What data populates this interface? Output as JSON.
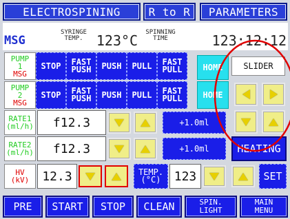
{
  "tabs": {
    "electrospinning": "ELECTROSPINING",
    "r_to_r": "R to R",
    "parameters": "PARAMETERS"
  },
  "header": {
    "msg": "MSG",
    "syringe_temp_l1": "SYRINGE",
    "syringe_temp_l2": "TEMP.",
    "syringe_temp_value": "123°C",
    "spinning_time_l1": "SPINNING",
    "spinning_time_l2": "TIME",
    "spinning_time_value": "123:12:12"
  },
  "pump1": {
    "label_l1": "PUMP",
    "label_l2": "1",
    "label_l3": "MSG",
    "stop": "STOP",
    "fast_push_l1": "FAST",
    "fast_push_l2": "PUSH",
    "push": "PUSH",
    "pull": "PULL",
    "fast_pull_l1": "FAST",
    "fast_pull_l2": "PULL",
    "home": "HOME"
  },
  "pump2": {
    "label_l1": "PUMP",
    "label_l2": "2",
    "label_l3": "MSG",
    "stop": "STOP",
    "fast_push_l1": "FAST",
    "fast_push_l2": "PUSH",
    "push": "PUSH",
    "pull": "PULL",
    "fast_pull_l1": "FAST",
    "fast_pull_l2": "PULL",
    "home": "HOME"
  },
  "slider": {
    "label": "SLIDER"
  },
  "rate1": {
    "label_l1": "RATE1",
    "label_l2": "(ml/h)",
    "value": "f12.3",
    "step": "+1.0ml"
  },
  "rate2": {
    "label_l1": "RATE2",
    "label_l2": "(ml/h)",
    "value": "f12.3",
    "step": "+1.0ml"
  },
  "heating": {
    "label": "HEATING"
  },
  "hv": {
    "label_l1": "HV",
    "label_l2": "(kV)",
    "value": "12.3"
  },
  "temp": {
    "label_l1": "TEMP.",
    "label_l2": "(°C)",
    "value": "123",
    "set": "SET"
  },
  "bottom": {
    "pre": "PRE",
    "start": "START",
    "stop": "STOP",
    "clean": "CLEAN",
    "spin_light_l1": "SPIN.",
    "spin_light_l2": "LIGHT",
    "main_menu_l1": "MAIN",
    "main_menu_l2": "MENU"
  },
  "colors": {
    "panel_bg": "#d4d8e0",
    "button_blue": "#1a1ee8",
    "home_cyan": "#27e0ee",
    "label_green": "#22cc22",
    "label_red": "#e00000",
    "arrow_yellow": "#e7d000",
    "annotation_red": "#e00000"
  }
}
